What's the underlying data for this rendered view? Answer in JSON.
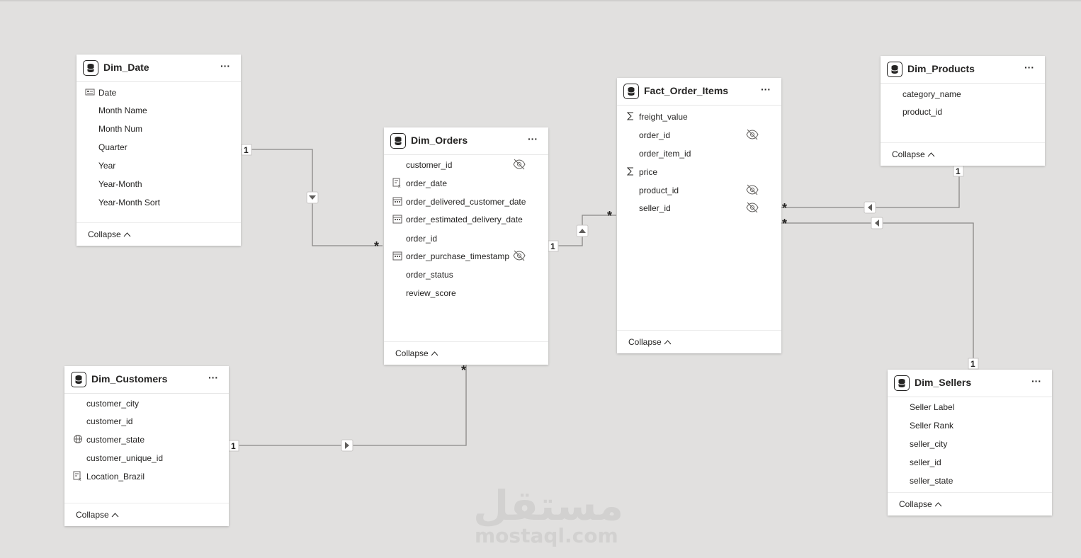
{
  "tables": {
    "dim_date": {
      "name": "Dim_Date",
      "fields": [
        "Date",
        "Month Name",
        "Month Num",
        "Quarter",
        "Year",
        "Year-Month",
        "Year-Month Sort"
      ],
      "collapse": "Collapse"
    },
    "dim_orders": {
      "name": "Dim_Orders",
      "fields": [
        "customer_id",
        "order_date",
        "order_delivered_customer_date",
        "order_estimated_delivery_date",
        "order_id",
        "order_purchase_timestamp",
        "order_status",
        "review_score"
      ],
      "collapse": "Collapse"
    },
    "fact_order_items": {
      "name": "Fact_Order_Items",
      "fields": [
        "freight_value",
        "order_id",
        "order_item_id",
        "price",
        "product_id",
        "seller_id"
      ],
      "collapse": "Collapse"
    },
    "dim_products": {
      "name": "Dim_Products",
      "fields": [
        "category_name",
        "product_id"
      ],
      "collapse": "Collapse"
    },
    "dim_customers": {
      "name": "Dim_Customers",
      "fields": [
        "customer_city",
        "customer_id",
        "customer_state",
        "customer_unique_id",
        "Location_Brazil"
      ],
      "collapse": "Collapse"
    },
    "dim_sellers": {
      "name": "Dim_Sellers",
      "fields": [
        "Seller Label",
        "Seller Rank",
        "seller_city",
        "seller_id",
        "seller_state"
      ],
      "collapse": "Collapse"
    }
  },
  "relationships": [
    {
      "from": "Dim_Date",
      "to": "Dim_Orders",
      "from_card": "1",
      "to_card": "*"
    },
    {
      "from": "Dim_Orders",
      "to": "Fact_Order_Items",
      "from_card": "1",
      "to_card": "*"
    },
    {
      "from": "Dim_Products",
      "to": "Fact_Order_Items",
      "from_card": "1",
      "to_card": "*"
    },
    {
      "from": "Dim_Sellers",
      "to": "Fact_Order_Items",
      "from_card": "1",
      "to_card": "*"
    },
    {
      "from": "Dim_Customers",
      "to": "Dim_Orders",
      "from_card": "1",
      "to_card": "*"
    }
  ],
  "more_label": "···",
  "watermark": {
    "arabic": "مستقل",
    "latin": "mostaql.com"
  },
  "colors": {
    "canvas": "#e1e0df",
    "card": "#ffffff",
    "line": "#8a8886",
    "text": "#252423"
  }
}
